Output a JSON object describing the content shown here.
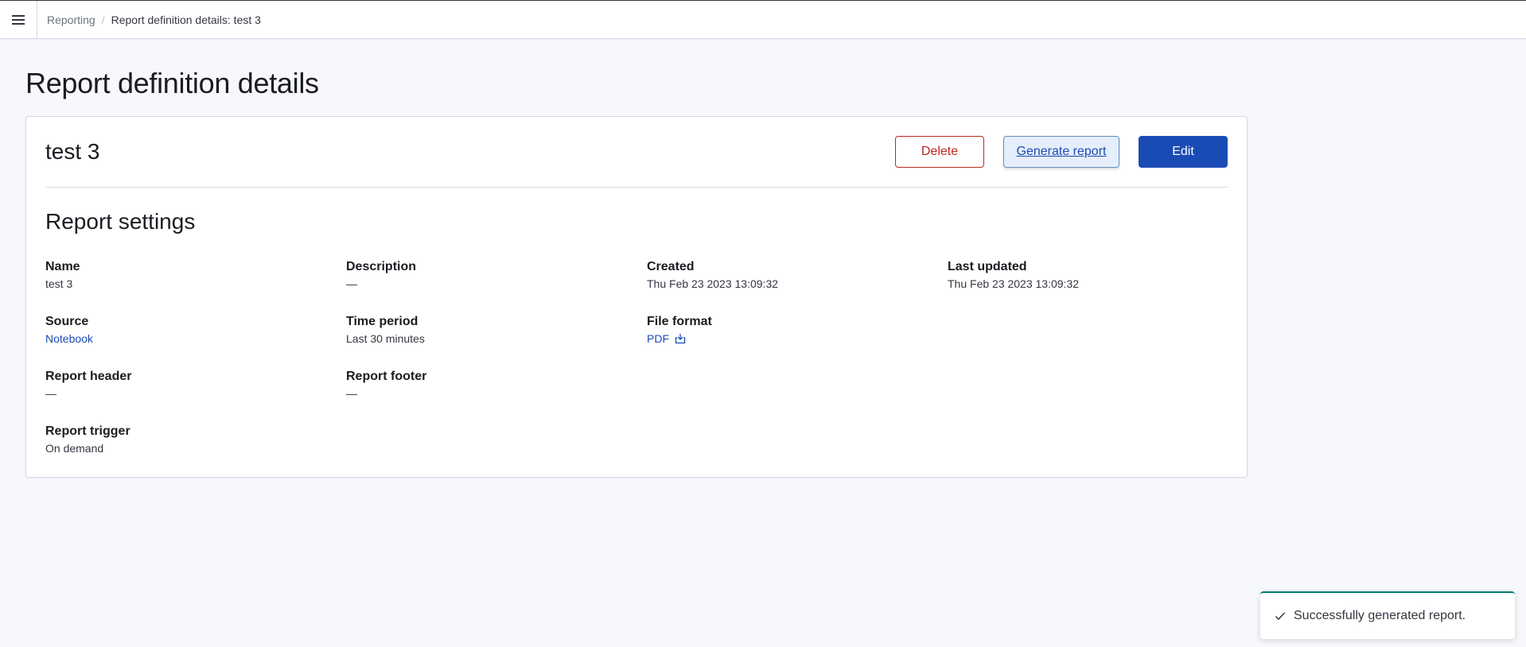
{
  "breadcrumbs": {
    "parent": "Reporting",
    "separator": "/",
    "current": "Report definition details: test 3"
  },
  "page_title": "Report definition details",
  "definition": {
    "name": "test 3",
    "actions": {
      "delete": "Delete",
      "generate": "Generate report",
      "edit": "Edit"
    }
  },
  "settings": {
    "title": "Report settings",
    "name_label": "Name",
    "name_value": "test 3",
    "description_label": "Description",
    "description_value": "—",
    "created_label": "Created",
    "created_value": "Thu Feb 23 2023 13:09:32",
    "last_updated_label": "Last updated",
    "last_updated_value": "Thu Feb 23 2023 13:09:32",
    "source_label": "Source",
    "source_value": "Notebook",
    "time_period_label": "Time period",
    "time_period_value": "Last 30 minutes",
    "file_format_label": "File format",
    "file_format_value": "PDF",
    "header_label": "Report header",
    "header_value": "—",
    "footer_label": "Report footer",
    "footer_value": "—",
    "trigger_label": "Report trigger",
    "trigger_value": "On demand"
  },
  "toast": {
    "message": "Successfully generated report."
  },
  "icons": {
    "menu": "hamburger-menu-icon",
    "download": "download-icon",
    "check": "check-icon"
  },
  "colors": {
    "primary": "#1a4bb5",
    "danger": "#bd271e",
    "success": "#017d73"
  }
}
